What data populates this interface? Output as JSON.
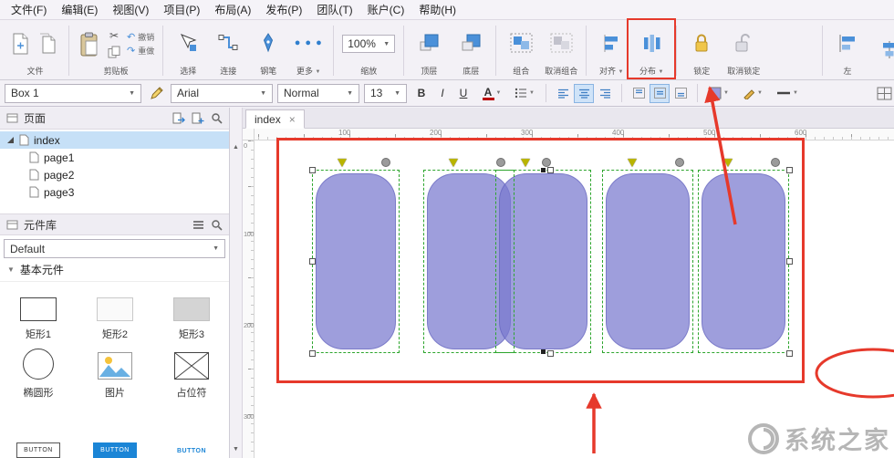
{
  "menu": {
    "items": [
      {
        "label": "文件(F)"
      },
      {
        "label": "编辑(E)"
      },
      {
        "label": "视图(V)"
      },
      {
        "label": "项目(P)"
      },
      {
        "label": "布局(A)"
      },
      {
        "label": "发布(P)"
      },
      {
        "label": "团队(T)"
      },
      {
        "label": "账户(C)"
      },
      {
        "label": "帮助(H)"
      }
    ]
  },
  "toolbar": {
    "file_group": "文件",
    "clipboard_group": "剪贴板",
    "undo": "撤销",
    "redo": "重做",
    "select": "选择",
    "connect": "连接",
    "pen": "钢笔",
    "more": "更多",
    "zoom_value": "100%",
    "zoom_label": "缩放",
    "bring_front": "顶层",
    "send_back": "底层",
    "group": "组合",
    "ungroup": "取消组合",
    "align": "对齐",
    "distribute": "分布",
    "lock": "锁定",
    "unlock": "取消锁定",
    "align_left": "左",
    "dropdown_arrow": "▼"
  },
  "stylebar": {
    "shape_style": "Box 1",
    "font_family": "Arial",
    "font_weight": "Normal",
    "font_size": "13",
    "bold": "B",
    "italic": "I",
    "underline": "U",
    "color": "A"
  },
  "sidebar": {
    "pages_panel": {
      "title": "页面"
    },
    "pages": [
      {
        "name": "index"
      },
      {
        "name": "page1"
      },
      {
        "name": "page2"
      },
      {
        "name": "page3"
      }
    ],
    "library_panel": {
      "title": "元件库",
      "selected_library": "Default",
      "section": "基本元件"
    },
    "widgets": [
      {
        "label": "矩形1"
      },
      {
        "label": "矩形2"
      },
      {
        "label": "矩形3"
      },
      {
        "label": "椭圆形"
      },
      {
        "label": "图片"
      },
      {
        "label": "占位符"
      }
    ],
    "button_widget_label": "BUTTON"
  },
  "canvas": {
    "tab": {
      "name": "index",
      "close": "×"
    },
    "h_ruler": [
      {
        "v": "100"
      },
      {
        "v": "200"
      },
      {
        "v": "300"
      },
      {
        "v": "400"
      },
      {
        "v": "500"
      },
      {
        "v": "600"
      }
    ],
    "v_ruler": [
      {
        "v": "0"
      },
      {
        "v": "100"
      },
      {
        "v": "200"
      },
      {
        "v": "300"
      }
    ]
  },
  "watermark": {
    "text": "系统之家"
  },
  "colors": {
    "accent_blue": "#4a90d9",
    "shape_purple": "#9c9cdd",
    "annotation_red": "#e6392b",
    "selection_green": "#2da52d"
  }
}
